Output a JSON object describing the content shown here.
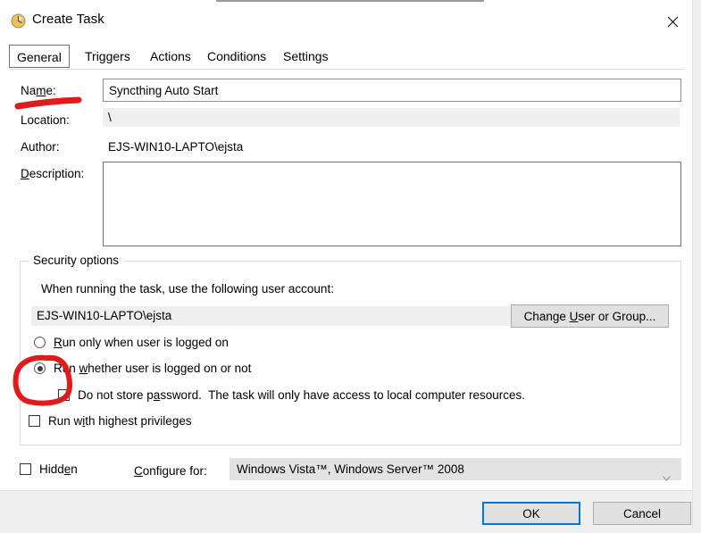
{
  "window": {
    "title": "Create Task",
    "title_icon": "clock-icon",
    "close_icon": "close-icon"
  },
  "tabs": [
    {
      "label": "General",
      "selected": true
    },
    {
      "label": "Triggers",
      "selected": false
    },
    {
      "label": "Actions",
      "selected": false
    },
    {
      "label": "Conditions",
      "selected": false
    },
    {
      "label": "Settings",
      "selected": false
    }
  ],
  "general": {
    "name_label": "Name:",
    "name_value": "Syncthing Auto Start",
    "name_placeholder": "",
    "location_label": "Location:",
    "location_value": "\\",
    "author_label": "Author:",
    "author_value": "EJS-WIN10-LAPTO\\ejsta",
    "description_label": "Description:",
    "description_value": "",
    "description_placeholder": ""
  },
  "security": {
    "group_title": "Security options",
    "account_prompt": "When running the task, use the following user account:",
    "account_value": "EJS-WIN10-LAPTO\\ejsta",
    "change_user_button": "Change User or Group...",
    "radio_logged_on": "Run only when user is logged on",
    "radio_logged_on_checked": false,
    "radio_whether": "Run whether user is logged on or not",
    "radio_whether_checked": true,
    "check_no_password": "Do not store password.  The task will only have access to local computer resources.",
    "check_no_password_checked": false,
    "check_highest_privileges": "Run with highest privileges",
    "check_highest_privileges_checked": false
  },
  "bottom": {
    "hidden_label": "Hidden",
    "hidden_checked": false,
    "configure_label": "Configure for:",
    "configure_value": "Windows Vista™, Windows Server™ 2008",
    "configure_chevron": "chevron-down-icon"
  },
  "footer": {
    "ok_label": "OK",
    "cancel_label": "Cancel"
  },
  "annotations": {
    "accent_red": "#e01b1b",
    "focus_blue": "#0078d7",
    "name_underline": "red-underline-stroke",
    "radio_circle": "red-circle-stroke"
  }
}
